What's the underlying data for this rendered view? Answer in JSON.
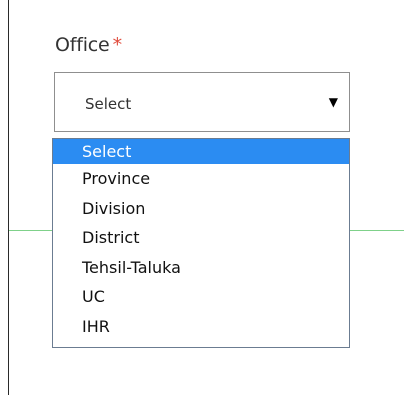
{
  "form": {
    "office_label": "Office",
    "required_marker": "*",
    "select_value": "Select",
    "select_arrow": "▼"
  },
  "dropdown": {
    "options": [
      {
        "label": "Select",
        "selected": true
      },
      {
        "label": "Province",
        "selected": false
      },
      {
        "label": "Division",
        "selected": false
      },
      {
        "label": "District",
        "selected": false
      },
      {
        "label": "Tehsil-Taluka",
        "selected": false
      },
      {
        "label": "UC",
        "selected": false
      },
      {
        "label": "IHR",
        "selected": false
      }
    ]
  },
  "colors": {
    "required": "#e04a3b",
    "highlight": "#2b8cf2",
    "divider": "#7fd18a"
  }
}
